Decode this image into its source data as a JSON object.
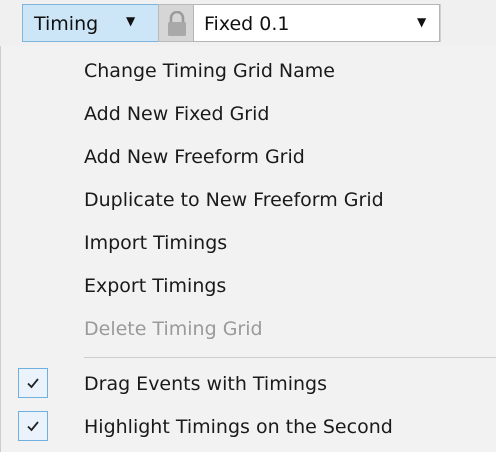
{
  "toolbar": {
    "timing_label": "Timing",
    "timing_caret": "▼",
    "lock_icon": "lock-icon",
    "grid_select_value": "Fixed 0.1",
    "grid_select_caret": "▼"
  },
  "menu": {
    "items": [
      {
        "label": "Change Timing Grid Name",
        "enabled": true
      },
      {
        "label": "Add New Fixed Grid",
        "enabled": true
      },
      {
        "label": "Add New Freeform Grid",
        "enabled": true
      },
      {
        "label": "Duplicate to New Freeform Grid",
        "enabled": true
      },
      {
        "label": "Import Timings",
        "enabled": true
      },
      {
        "label": "Export Timings",
        "enabled": true
      },
      {
        "label": "Delete Timing Grid",
        "enabled": false
      }
    ],
    "check_items": [
      {
        "label": "Drag Events with Timings",
        "checked": true
      },
      {
        "label": "Highlight Timings on the Second",
        "checked": true
      }
    ]
  },
  "colors": {
    "accent": "#cde6f7",
    "accent_border": "#7fb4dc",
    "menu_bg": "#f2f2f2",
    "disabled_text": "#9a9a9a"
  }
}
